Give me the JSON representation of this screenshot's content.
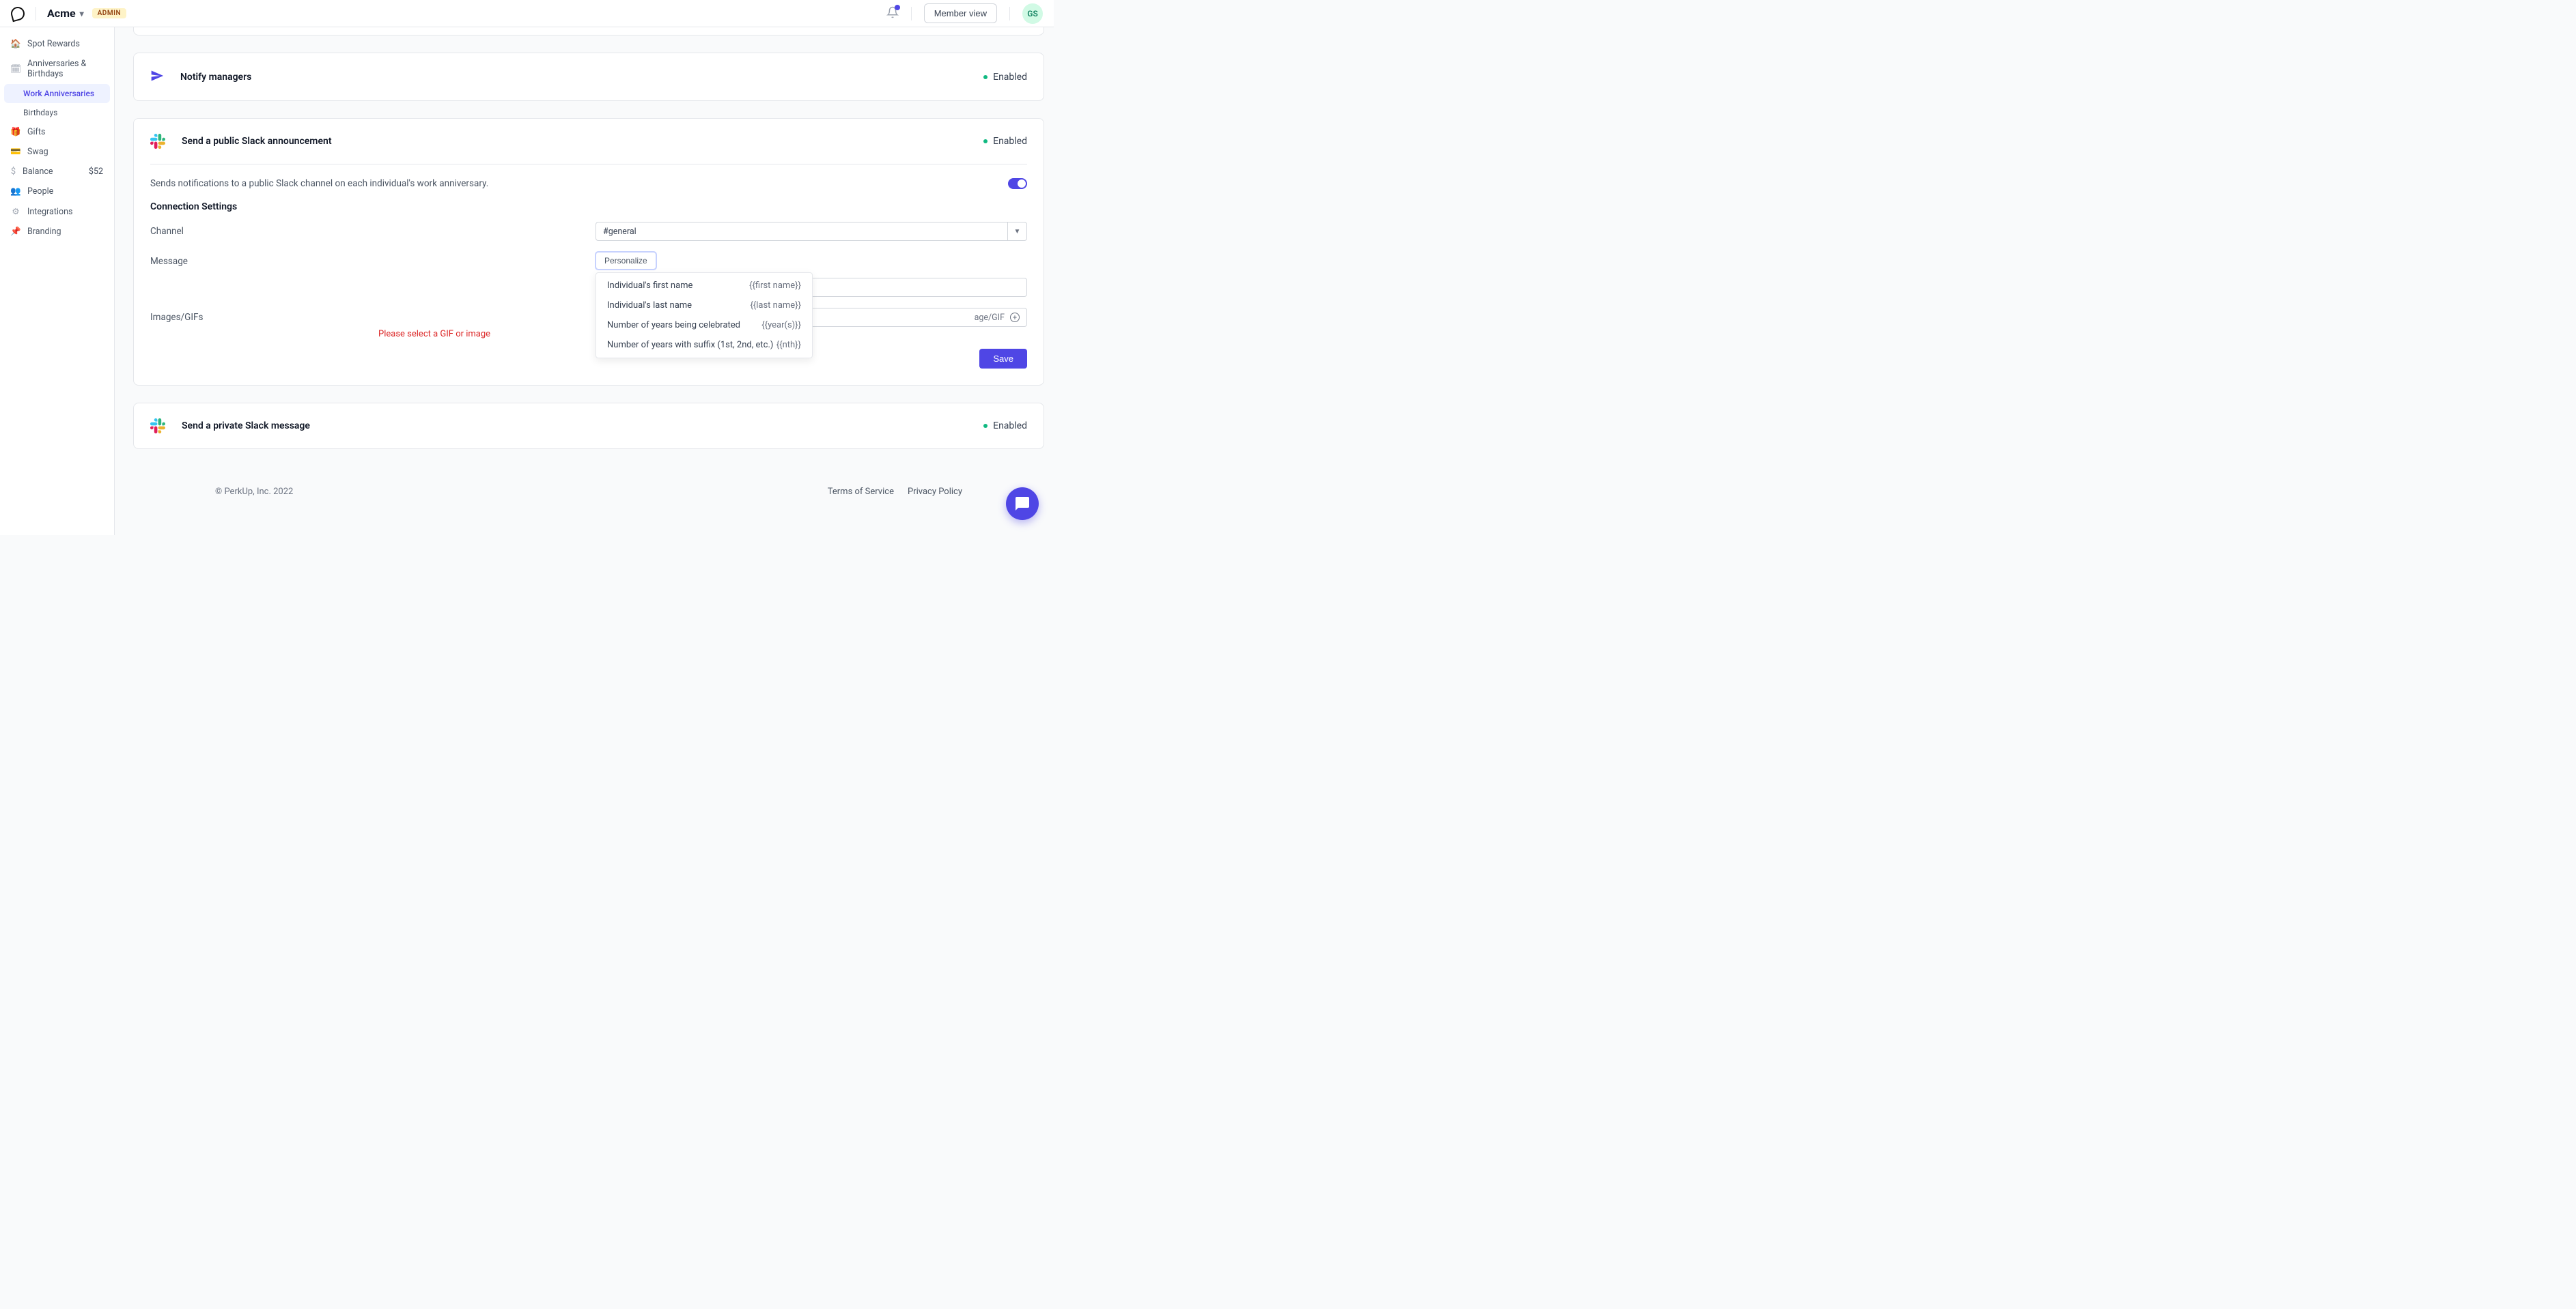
{
  "header": {
    "org_name": "Acme",
    "admin_badge": "ADMIN",
    "member_view": "Member view",
    "avatar_initials": "GS"
  },
  "sidebar": {
    "spot_rewards": "Spot Rewards",
    "anniv_birthdays": "Anniversaries & Birthdays",
    "work_anniversaries": "Work Anniversaries",
    "birthdays": "Birthdays",
    "gifts": "Gifts",
    "swag": "Swag",
    "balance_label": "Balance",
    "balance_value": "$52",
    "people": "People",
    "integrations": "Integrations",
    "branding": "Branding"
  },
  "cards": {
    "notify_managers": {
      "title": "Notify managers",
      "status": "Enabled"
    },
    "public_slack": {
      "title": "Send a public Slack announcement",
      "status": "Enabled",
      "description": "Sends notifications to a public Slack channel on each individual's work anniversary.",
      "section_title": "Connection Settings",
      "channel_label": "Channel",
      "channel_value": "#general",
      "message_label": "Message",
      "personalize_btn": "Personalize",
      "images_label": "Images/GIFs",
      "image_placeholder": "age/GIF",
      "error_visible": "Please select a GIF or image",
      "save_btn": "Save",
      "dropdown": [
        {
          "label": "Individual's first name",
          "token": "{{first name}}"
        },
        {
          "label": "Individual's last name",
          "token": "{{last name}}"
        },
        {
          "label": "Number of years being celebrated",
          "token": "{{year(s)}}"
        },
        {
          "label": "Number of years with suffix (1st, 2nd, etc.)",
          "token": "{{nth}}"
        }
      ]
    },
    "private_slack": {
      "title": "Send a private Slack message",
      "status": "Enabled"
    }
  },
  "footer": {
    "copyright": "© PerkUp, Inc. 2022",
    "terms": "Terms of Service",
    "privacy": "Privacy Policy"
  }
}
